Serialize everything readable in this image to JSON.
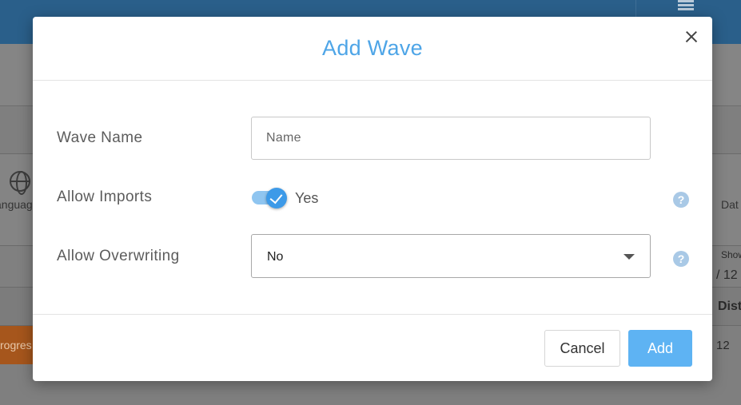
{
  "background": {
    "left_cut_text": "anguag",
    "right_cut_text": "Dat",
    "show_text": "Show",
    "pagination": "/ 12",
    "column_header": "Dist",
    "cell_value": "12",
    "progress_text": "rogres"
  },
  "modal": {
    "title": "Add Wave",
    "fields": {
      "wave_name": {
        "label": "Wave Name",
        "placeholder": "Name",
        "value": ""
      },
      "allow_imports": {
        "label": "Allow Imports",
        "state": "Yes",
        "checked": true
      },
      "allow_overwriting": {
        "label": "Allow Overwriting",
        "selected": "No"
      }
    },
    "help_symbol": "?",
    "buttons": {
      "cancel": "Cancel",
      "add": "Add"
    }
  },
  "colors": {
    "title": "#4ea5e7",
    "primary_button": "#5eb3f3",
    "toggle_on": "#3d9ae8",
    "help_icon": "#a9c9e6"
  },
  "icons": [
    "close-icon",
    "check-icon",
    "help-icon",
    "chevron-down-icon",
    "globe-icon",
    "list-icon"
  ]
}
